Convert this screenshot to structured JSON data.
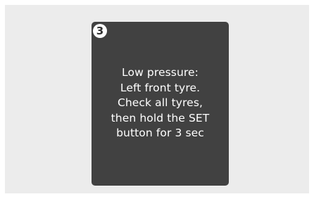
{
  "badge": {
    "number": "3"
  },
  "display": {
    "lines": [
      "Low pressure:",
      "Left front tyre.",
      "Check all tyres,",
      "then hold the SET",
      "button for 3 sec"
    ]
  },
  "colors": {
    "background": "#ececec",
    "screen": "#414141",
    "text": "#ffffff",
    "badge": "#ffffff"
  }
}
